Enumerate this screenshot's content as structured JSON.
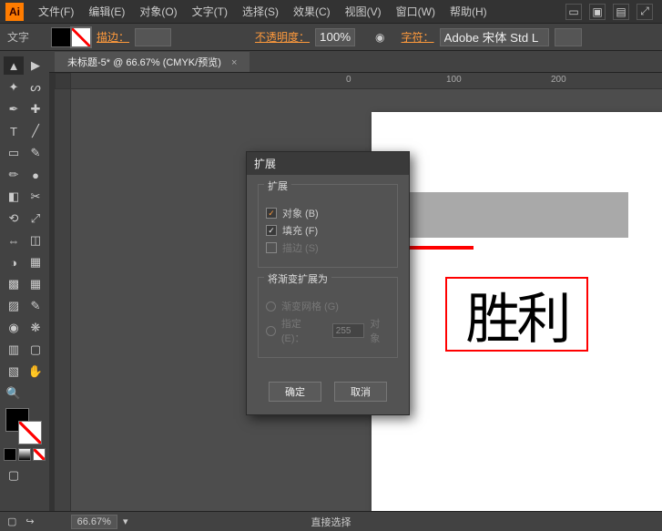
{
  "app": {
    "logo": "Ai"
  },
  "menu": {
    "file": "文件(F)",
    "edit": "编辑(E)",
    "object": "对象(O)",
    "text": "文字(T)",
    "select": "选择(S)",
    "effect": "效果(C)",
    "view": "视图(V)",
    "window": "窗口(W)",
    "help": "帮助(H)"
  },
  "optbar": {
    "mode_label": "文字",
    "stroke_label": "描边：",
    "opacity_label": "不透明度：",
    "opacity_value": "100%",
    "char_label": "字符：",
    "font_name": "Adobe 宋体 Std L"
  },
  "doc_tab": {
    "title": "未标题-5* @ 66.67% (CMYK/预览)",
    "close": "×"
  },
  "rulers": {
    "mark0": "0",
    "mark100": "100",
    "mark200": "200"
  },
  "canvas": {
    "text_content": "胜利"
  },
  "dialog": {
    "title": "扩展",
    "group1_label": "扩展",
    "opt_object": "对象 (B)",
    "opt_fill": "填充 (F)",
    "opt_stroke": "描边 (S)",
    "group2_label": "将渐变扩展为",
    "opt_gradient_mesh": "渐变网格 (G)",
    "opt_specify_pre": "指定 (E)：",
    "opt_specify_value": "255",
    "opt_specify_post": "对象",
    "btn_ok": "确定",
    "btn_cancel": "取消"
  },
  "status": {
    "zoom": "66.67%",
    "tool_hint": "直接选择"
  }
}
